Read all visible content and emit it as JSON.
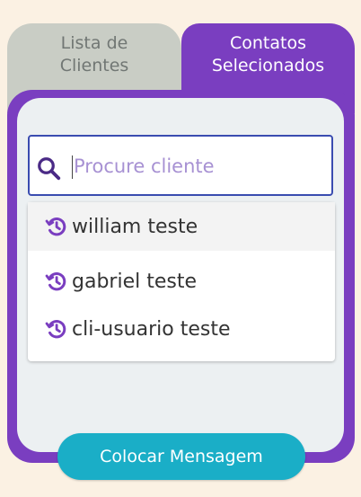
{
  "tabs": {
    "clients": {
      "line1": "Lista de",
      "line2": "Clientes",
      "active": false
    },
    "selected": {
      "line1": "Contatos",
      "line2": "Selecionados",
      "active": true
    }
  },
  "search": {
    "placeholder": "Procure cliente",
    "value": "",
    "icon": "search-icon"
  },
  "results": [
    {
      "label": "william teste",
      "icon": "history-icon"
    },
    {
      "label": "gabriel teste",
      "icon": "history-icon"
    },
    {
      "label": "cli-usuario teste",
      "icon": "history-icon"
    }
  ],
  "footer": {
    "button_label": "Colocar Mensagem"
  },
  "colors": {
    "accent": "#7a3ec0",
    "inactive_tab": "#c9cdc5",
    "background": "#fbf1e3",
    "button": "#1aaec7",
    "panel": "#ecf0f2"
  }
}
